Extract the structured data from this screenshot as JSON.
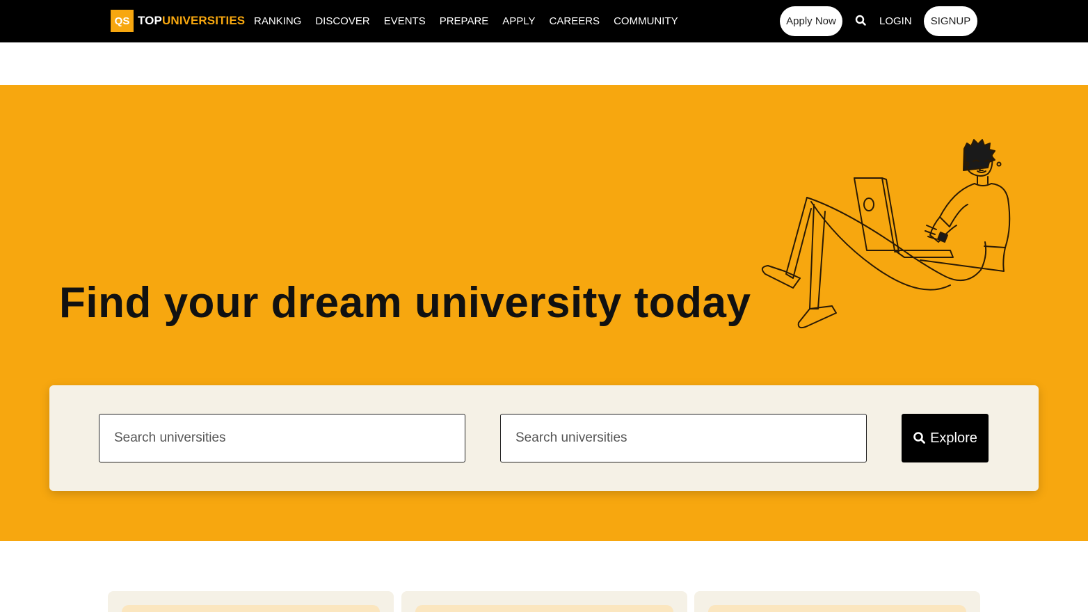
{
  "brand": {
    "logo_mark": "QS",
    "logo_top": "TOP",
    "logo_universities": "UNIVERSITIES",
    "accent_color": "#f7a70f"
  },
  "nav": {
    "items": [
      {
        "label": "RANKING"
      },
      {
        "label": "DISCOVER"
      },
      {
        "label": "EVENTS"
      },
      {
        "label": "PREPARE"
      },
      {
        "label": "APPLY"
      },
      {
        "label": "CAREERS"
      },
      {
        "label": "COMMUNITY"
      }
    ],
    "apply_now": "Apply Now",
    "search_icon": "search-icon",
    "login": "LOGIN",
    "signup": "SIGNUP"
  },
  "hero": {
    "title": "Find your dream university today",
    "illustration": "person-with-laptop-illustration",
    "background_color": "#f7a70f"
  },
  "search": {
    "field_1_placeholder": "Search universities",
    "field_2_placeholder": "Search universities",
    "explore_label": "Explore"
  }
}
